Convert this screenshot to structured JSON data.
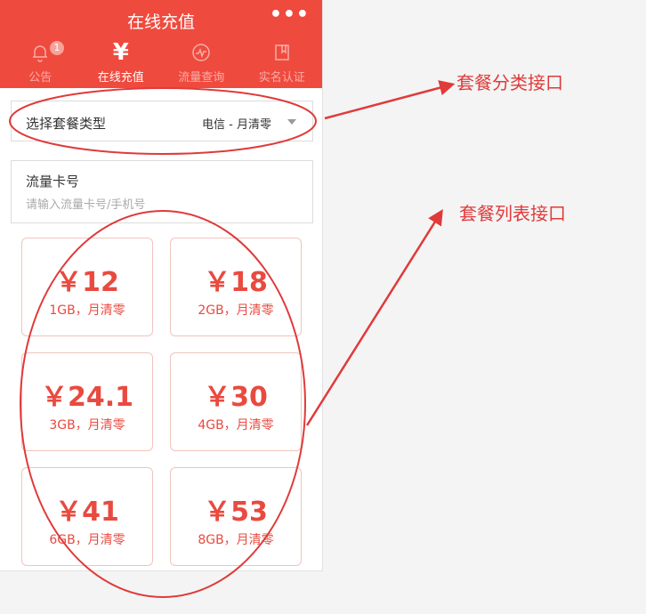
{
  "header": {
    "title": "在线充值",
    "more": "•••",
    "tabs": [
      {
        "label": "公告",
        "icon": "bell-icon",
        "badge": "1",
        "active": false
      },
      {
        "label": "在线充值",
        "icon": "yen-icon",
        "active": true
      },
      {
        "label": "流量查询",
        "icon": "wave-icon",
        "active": false
      },
      {
        "label": "实名认证",
        "icon": "book-icon",
        "active": false
      }
    ]
  },
  "plan_type": {
    "label": "选择套餐类型",
    "value": "电信 - 月清零"
  },
  "card": {
    "label": "流量卡号",
    "placeholder": "请输入流量卡号/手机号",
    "value": ""
  },
  "plans": [
    {
      "price": "￥12",
      "desc": "1GB，月清零"
    },
    {
      "price": "￥18",
      "desc": "2GB，月清零"
    },
    {
      "price": "￥24.1",
      "desc": "3GB，月清零"
    },
    {
      "price": "￥30",
      "desc": "4GB，月清零"
    },
    {
      "price": "￥41",
      "desc": "6GB，月清零"
    },
    {
      "price": "￥53",
      "desc": "8GB，月清零"
    }
  ],
  "annotations": {
    "category_api": "套餐分类接口",
    "list_api": "套餐列表接口"
  },
  "colors": {
    "brand": "#ef4a3e",
    "accent": "#e94a3f",
    "annotation": "#e03a3a"
  }
}
